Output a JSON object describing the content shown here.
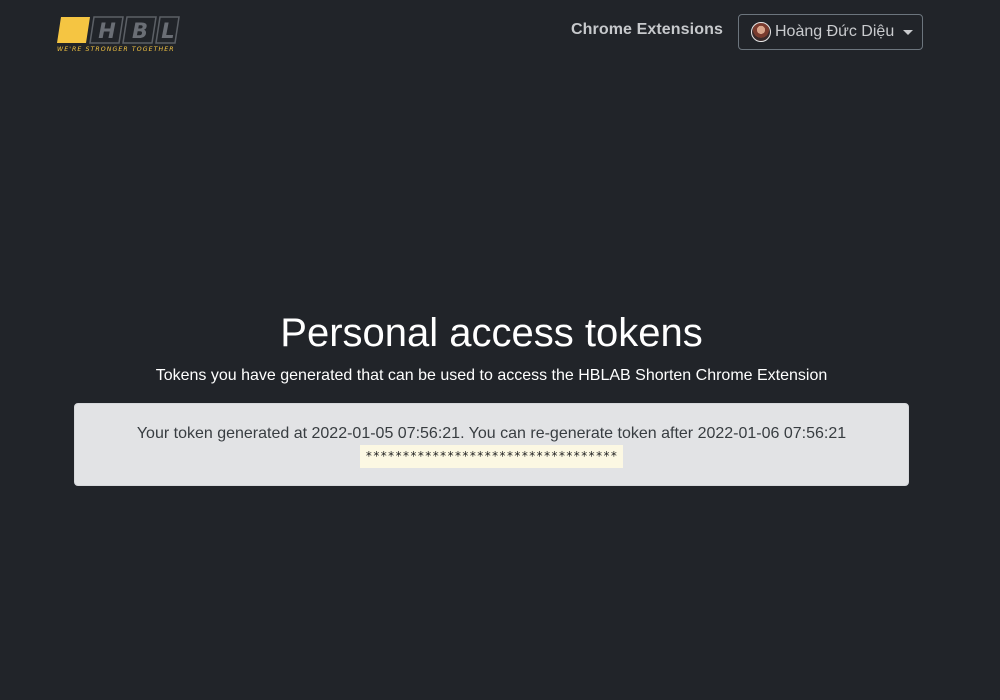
{
  "navbar": {
    "logo": {
      "letters": [
        "H",
        "B",
        "L"
      ],
      "tagline": "WE'RE STRONGER TOGETHER",
      "accent_color": "#f5c542"
    },
    "link_label": "Chrome Extensions",
    "user": {
      "name": "Hoàng Đức Diệu",
      "avatar_icon": "user-avatar-icon"
    }
  },
  "main": {
    "title": "Personal access tokens",
    "subtitle": "Tokens you have generated that can be used to access the HBLAB Shorten Chrome Extension",
    "token_card": {
      "info": "Your token generated at 2022-01-05 07:56:21. You can re-generate token after 2022-01-06 07:56:21",
      "token_masked": "**********************************"
    }
  },
  "colors": {
    "background": "#212429",
    "card_background": "#e2e3e5",
    "token_highlight": "#fcf8e3",
    "brand_yellow": "#f5c542"
  }
}
